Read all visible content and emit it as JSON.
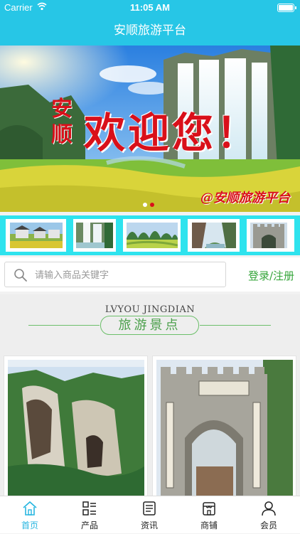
{
  "status_bar": {
    "carrier": "Carrier",
    "time": "11:05 AM"
  },
  "header": {
    "title": "安顺旅游平台"
  },
  "banner": {
    "side_text": "安顺",
    "welcome_text": "欢迎您！",
    "watermark": "@安顺旅游平台",
    "page_count": 2,
    "active_page": 2
  },
  "search": {
    "placeholder": "请输入商品关键字"
  },
  "login": {
    "label": "登录/注册"
  },
  "section": {
    "subtitle": "LVYOU JINGDIAN",
    "title": "旅游景点"
  },
  "tabbar": {
    "items": [
      {
        "label": "首页",
        "icon": "home-icon",
        "active": true
      },
      {
        "label": "产品",
        "icon": "grid-list-icon",
        "active": false
      },
      {
        "label": "资讯",
        "icon": "news-icon",
        "active": false
      },
      {
        "label": "商铺",
        "icon": "shop-icon",
        "active": false
      },
      {
        "label": "会员",
        "icon": "user-icon",
        "active": false
      }
    ]
  },
  "colors": {
    "brand": "#27c6e6",
    "accent_green": "#35a53a",
    "active_tab": "#27b6e0",
    "banner_red": "#d9101a"
  }
}
